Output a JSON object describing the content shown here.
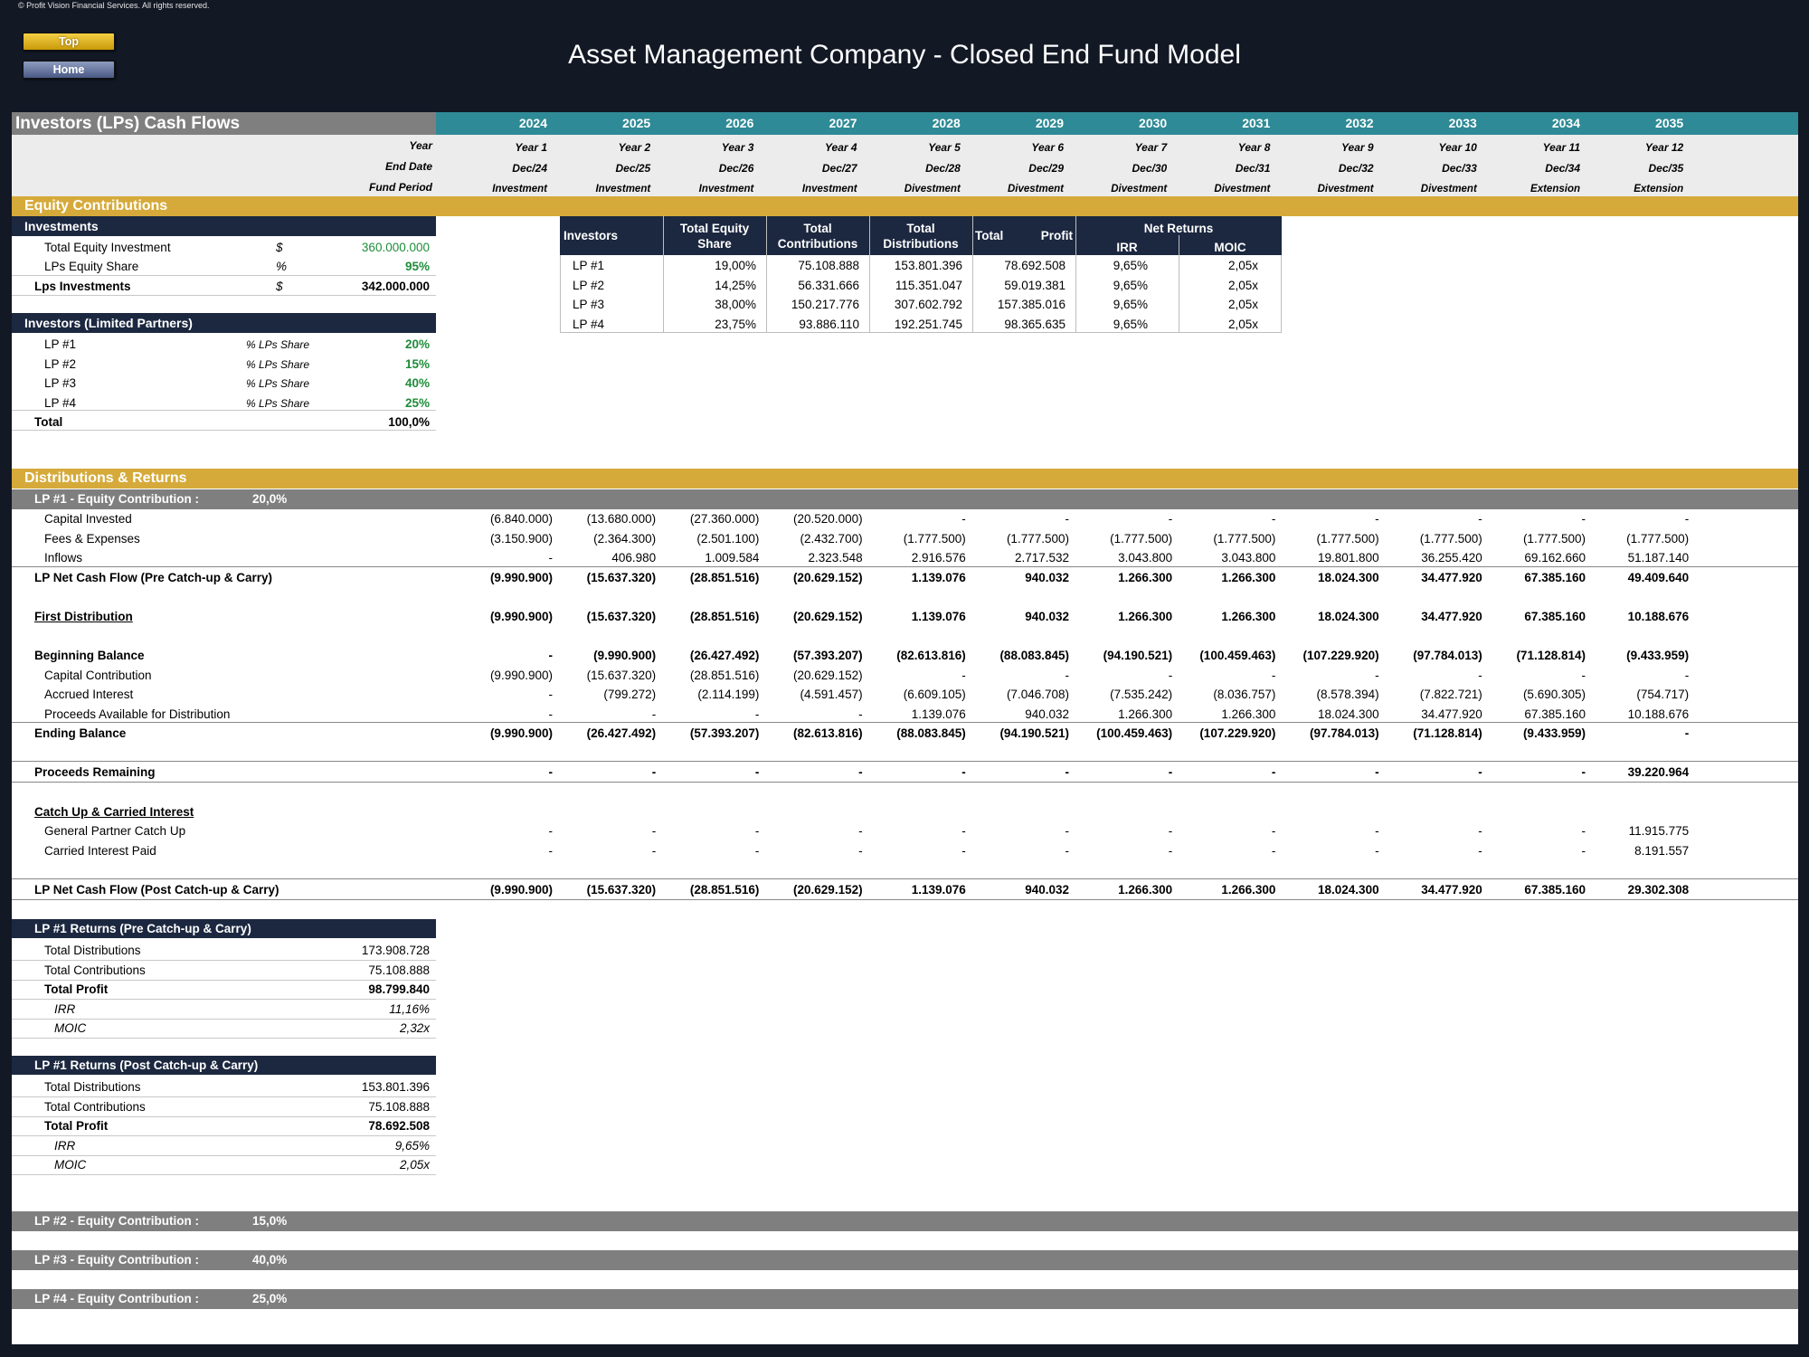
{
  "copyright": "© Profit Vision Financial Services. All rights reserved.",
  "nav": {
    "top": "Top",
    "home": "Home"
  },
  "title": "Asset Management Company - Closed End Fund Model",
  "section_title": "Investors (LPs) Cash Flows",
  "timeline": {
    "years": [
      "2024",
      "2025",
      "2026",
      "2027",
      "2028",
      "2029",
      "2030",
      "2031",
      "2032",
      "2033",
      "2034",
      "2035"
    ],
    "year_label": "Year",
    "year_nums": [
      "Year 1",
      "Year 2",
      "Year 3",
      "Year 4",
      "Year 5",
      "Year 6",
      "Year 7",
      "Year 8",
      "Year 9",
      "Year 10",
      "Year 11",
      "Year 12"
    ],
    "end_date_label": "End Date",
    "end_dates": [
      "Dec/24",
      "Dec/25",
      "Dec/26",
      "Dec/27",
      "Dec/28",
      "Dec/29",
      "Dec/30",
      "Dec/31",
      "Dec/32",
      "Dec/33",
      "Dec/34",
      "Dec/35"
    ],
    "period_label": "Fund Period",
    "periods": [
      "Investment",
      "Investment",
      "Investment",
      "Investment",
      "Divestment",
      "Divestment",
      "Divestment",
      "Divestment",
      "Divestment",
      "Divestment",
      "Extension",
      "Extension"
    ]
  },
  "equity": {
    "header": "Equity Contributions",
    "investments": {
      "header": "Investments",
      "rows": [
        {
          "label": "Total Equity Investment",
          "unit": "$",
          "value": "360.000.000"
        },
        {
          "label": "LPs Equity Share",
          "unit": "%",
          "value": "95%"
        },
        {
          "label": "Lps Investments",
          "unit": "$",
          "value": "342.000.000"
        }
      ]
    },
    "investors": {
      "header": "Investors (Limited Partners)",
      "rows": [
        {
          "label": "LP #1",
          "unit": "% LPs Share",
          "value": "20%"
        },
        {
          "label": "LP #2",
          "unit": "% LPs Share",
          "value": "15%"
        },
        {
          "label": "LP #3",
          "unit": "% LPs Share",
          "value": "40%"
        },
        {
          "label": "LP #4",
          "unit": "% LPs Share",
          "value": "25%"
        }
      ],
      "total_label": "Total",
      "total_value": "100,0%"
    },
    "summary": {
      "headers": {
        "investors": "Investors",
        "share": [
          "Total Equity",
          "Share"
        ],
        "contributions": [
          "Total",
          "Contributions"
        ],
        "distributions": [
          "Total",
          "Distributions"
        ],
        "profit_a": "Total",
        "profit_b": "Profit",
        "net_returns": "Net Returns",
        "irr": "IRR",
        "moic": "MOIC"
      },
      "rows": [
        [
          "LP #1",
          "19,00%",
          "75.108.888",
          "153.801.396",
          "78.692.508",
          "9,65%",
          "2,05x"
        ],
        [
          "LP #2",
          "14,25%",
          "56.331.666",
          "115.351.047",
          "59.019.381",
          "9,65%",
          "2,05x"
        ],
        [
          "LP #3",
          "38,00%",
          "150.217.776",
          "307.602.792",
          "157.385.016",
          "9,65%",
          "2,05x"
        ],
        [
          "LP #4",
          "23,75%",
          "93.886.110",
          "192.251.745",
          "98.365.635",
          "9,65%",
          "2,05x"
        ]
      ]
    }
  },
  "distributions": {
    "header": "Distributions & Returns",
    "lp1_bar": {
      "label": "LP #1  - Equity Contribution :",
      "value": "20,0%"
    },
    "rows": [
      {
        "label": "Capital Invested",
        "values": [
          "(6.840.000)",
          "(13.680.000)",
          "(27.360.000)",
          "(20.520.000)",
          "-",
          "-",
          "-",
          "-",
          "-",
          "-",
          "-",
          "-"
        ]
      },
      {
        "label": "Fees & Expenses",
        "values": [
          "(3.150.900)",
          "(2.364.300)",
          "(2.501.100)",
          "(2.432.700)",
          "(1.777.500)",
          "(1.777.500)",
          "(1.777.500)",
          "(1.777.500)",
          "(1.777.500)",
          "(1.777.500)",
          "(1.777.500)",
          "(1.777.500)"
        ]
      },
      {
        "label": "Inflows",
        "values": [
          "-",
          "406.980",
          "1.009.584",
          "2.323.548",
          "2.916.576",
          "2.717.532",
          "3.043.800",
          "3.043.800",
          "19.801.800",
          "36.255.420",
          "69.162.660",
          "51.187.140"
        ]
      },
      {
        "label": "LP Net Cash Flow (Pre Catch-up & Carry)",
        "values": [
          "(9.990.900)",
          "(15.637.320)",
          "(28.851.516)",
          "(20.629.152)",
          "1.139.076",
          "940.032",
          "1.266.300",
          "1.266.300",
          "18.024.300",
          "34.477.920",
          "67.385.160",
          "49.409.640"
        ]
      },
      {
        "label": "First Distribution",
        "values": [
          "(9.990.900)",
          "(15.637.320)",
          "(28.851.516)",
          "(20.629.152)",
          "1.139.076",
          "940.032",
          "1.266.300",
          "1.266.300",
          "18.024.300",
          "34.477.920",
          "67.385.160",
          "10.188.676"
        ]
      },
      {
        "label": "Beginning Balance",
        "values": [
          "-",
          "(9.990.900)",
          "(26.427.492)",
          "(57.393.207)",
          "(82.613.816)",
          "(88.083.845)",
          "(94.190.521)",
          "(100.459.463)",
          "(107.229.920)",
          "(97.784.013)",
          "(71.128.814)",
          "(9.433.959)"
        ]
      },
      {
        "label": "Capital Contribution",
        "values": [
          "(9.990.900)",
          "(15.637.320)",
          "(28.851.516)",
          "(20.629.152)",
          "-",
          "-",
          "-",
          "-",
          "-",
          "-",
          "-",
          "-"
        ]
      },
      {
        "label": "Accrued Interest",
        "values": [
          "-",
          "(799.272)",
          "(2.114.199)",
          "(4.591.457)",
          "(6.609.105)",
          "(7.046.708)",
          "(7.535.242)",
          "(8.036.757)",
          "(8.578.394)",
          "(7.822.721)",
          "(5.690.305)",
          "(754.717)"
        ]
      },
      {
        "label": "Proceeds Available for Distribution",
        "values": [
          "-",
          "-",
          "-",
          "-",
          "1.139.076",
          "940.032",
          "1.266.300",
          "1.266.300",
          "18.024.300",
          "34.477.920",
          "67.385.160",
          "10.188.676"
        ]
      },
      {
        "label": "Ending Balance",
        "values": [
          "(9.990.900)",
          "(26.427.492)",
          "(57.393.207)",
          "(82.613.816)",
          "(88.083.845)",
          "(94.190.521)",
          "(100.459.463)",
          "(107.229.920)",
          "(97.784.013)",
          "(71.128.814)",
          "(9.433.959)",
          "-"
        ]
      },
      {
        "label": "Proceeds Remaining",
        "values": [
          "-",
          "-",
          "-",
          "-",
          "-",
          "-",
          "-",
          "-",
          "-",
          "-",
          "-",
          "39.220.964"
        ]
      },
      {
        "label": "Catch Up & Carried Interest",
        "values": []
      },
      {
        "label": "General Partner Catch Up",
        "values": [
          "-",
          "-",
          "-",
          "-",
          "-",
          "-",
          "-",
          "-",
          "-",
          "-",
          "-",
          "11.915.775"
        ]
      },
      {
        "label": "Carried Interest Paid",
        "values": [
          "-",
          "-",
          "-",
          "-",
          "-",
          "-",
          "-",
          "-",
          "-",
          "-",
          "-",
          "8.191.557"
        ]
      },
      {
        "label": "LP Net Cash Flow (Post Catch-up & Carry)",
        "values": [
          "(9.990.900)",
          "(15.637.320)",
          "(28.851.516)",
          "(20.629.152)",
          "1.139.076",
          "940.032",
          "1.266.300",
          "1.266.300",
          "18.024.300",
          "34.477.920",
          "67.385.160",
          "29.302.308"
        ]
      }
    ],
    "returns_pre": {
      "header": "LP #1 Returns (Pre Catch-up & Carry)",
      "rows": [
        {
          "label": "Total Distributions",
          "value": "173.908.728"
        },
        {
          "label": "Total Contributions",
          "value": "75.108.888"
        },
        {
          "label": "Total Profit",
          "value": "98.799.840"
        },
        {
          "label": "IRR",
          "value": "11,16%"
        },
        {
          "label": "MOIC",
          "value": "2,32x"
        }
      ]
    },
    "returns_post": {
      "header": "LP #1 Returns (Post Catch-up & Carry)",
      "rows": [
        {
          "label": "Total Distributions",
          "value": "153.801.396"
        },
        {
          "label": "Total Contributions",
          "value": "75.108.888"
        },
        {
          "label": "Total Profit",
          "value": "78.692.508"
        },
        {
          "label": "IRR",
          "value": "9,65%"
        },
        {
          "label": "MOIC",
          "value": "2,05x"
        }
      ]
    },
    "lp2_bar": {
      "label": "LP #2  - Equity Contribution :",
      "value": "15,0%"
    },
    "lp3_bar": {
      "label": "LP #3  - Equity Contribution :",
      "value": "40,0%"
    },
    "lp4_bar": {
      "label": "LP #4  - Equity Contribution :",
      "value": "25,0%"
    }
  }
}
